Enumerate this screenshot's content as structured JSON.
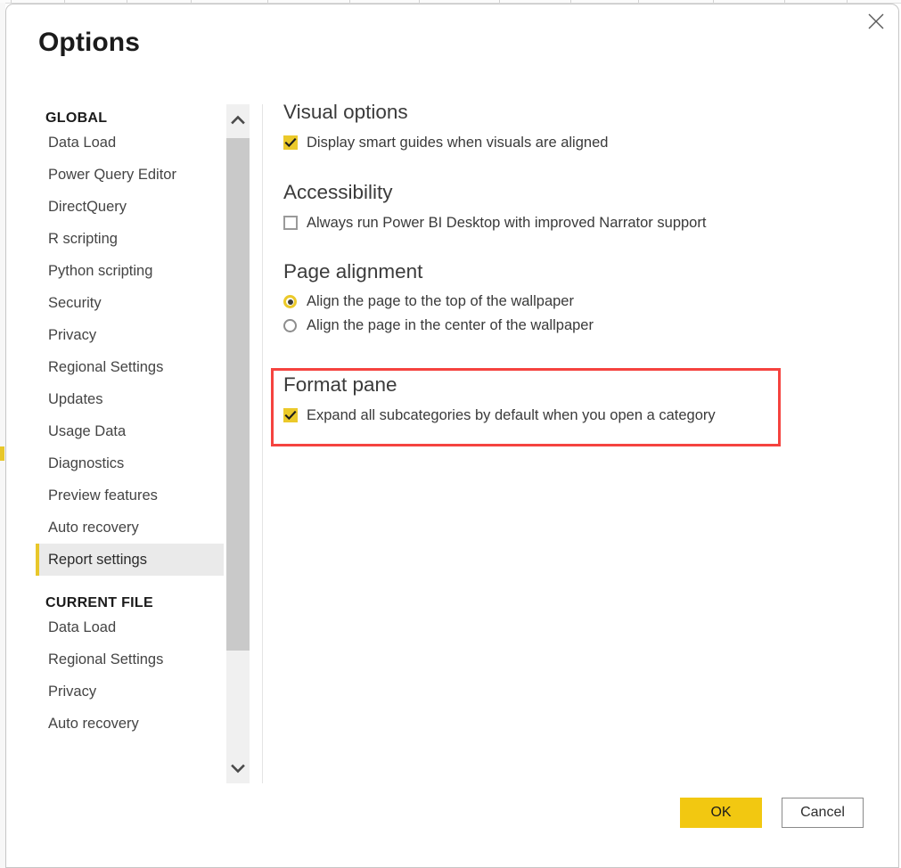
{
  "dialog": {
    "title": "Options",
    "close_label": "Close"
  },
  "sidebar": {
    "groups": [
      {
        "title": "GLOBAL",
        "items": [
          {
            "label": "Data Load",
            "selected": false
          },
          {
            "label": "Power Query Editor",
            "selected": false
          },
          {
            "label": "DirectQuery",
            "selected": false
          },
          {
            "label": "R scripting",
            "selected": false
          },
          {
            "label": "Python scripting",
            "selected": false
          },
          {
            "label": "Security",
            "selected": false
          },
          {
            "label": "Privacy",
            "selected": false
          },
          {
            "label": "Regional Settings",
            "selected": false
          },
          {
            "label": "Updates",
            "selected": false
          },
          {
            "label": "Usage Data",
            "selected": false
          },
          {
            "label": "Diagnostics",
            "selected": false
          },
          {
            "label": "Preview features",
            "selected": false
          },
          {
            "label": "Auto recovery",
            "selected": false
          },
          {
            "label": "Report settings",
            "selected": true
          }
        ]
      },
      {
        "title": "CURRENT FILE",
        "items": [
          {
            "label": "Data Load",
            "selected": false
          },
          {
            "label": "Regional Settings",
            "selected": false
          },
          {
            "label": "Privacy",
            "selected": false
          },
          {
            "label": "Auto recovery",
            "selected": false
          }
        ]
      }
    ],
    "scrollbar": {
      "up_icon": "chevron-up-icon",
      "down_icon": "chevron-down-icon"
    }
  },
  "content": {
    "visual_options": {
      "heading": "Visual options",
      "checkbox_label": "Display smart guides when visuals are aligned",
      "checked": true
    },
    "accessibility": {
      "heading": "Accessibility",
      "checkbox_label": "Always run Power BI Desktop with improved Narrator support",
      "checked": false
    },
    "page_alignment": {
      "heading": "Page alignment",
      "options": [
        {
          "label": "Align the page to the top of the wallpaper",
          "selected": true
        },
        {
          "label": "Align the page in the center of the wallpaper",
          "selected": false
        }
      ]
    },
    "format_pane": {
      "heading": "Format pane",
      "checkbox_label": "Expand all subcategories by default when you open a category",
      "checked": true,
      "highlighted": true
    }
  },
  "footer": {
    "ok_label": "OK",
    "cancel_label": "Cancel"
  },
  "colors": {
    "accent_yellow": "#f2c811",
    "checkbox_yellow": "#ebc92a",
    "selection_bar": "#e8c72a",
    "highlight_red": "#f5433f",
    "selected_row_bg": "#eaeaea",
    "scrollbar_thumb": "#c9c9c9",
    "scrollbar_track": "#f0f0f0"
  }
}
